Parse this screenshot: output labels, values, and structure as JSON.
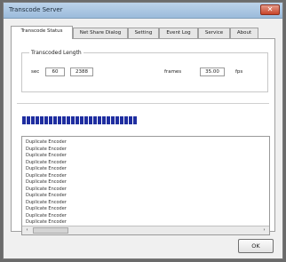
{
  "window": {
    "title": "Transcode Server",
    "close_glyph": "✕"
  },
  "tabs": [
    {
      "label": "Transcode Status",
      "active": true
    },
    {
      "label": "Net Share Dialog",
      "active": false
    },
    {
      "label": "Setting",
      "active": false
    },
    {
      "label": "Event Log",
      "active": false
    },
    {
      "label": "Service",
      "active": false
    },
    {
      "label": "About",
      "active": false
    }
  ],
  "transcoded_length": {
    "group_label": "Transcoded Length",
    "sec_label": "sec",
    "sec_value": "60",
    "frames_field_value": "2388",
    "frames_label": "frames",
    "fps_value": "35.00",
    "fps_label": "fps"
  },
  "progress": {
    "segments": 26
  },
  "log": {
    "lines": [
      "Duplicate Encoder",
      "Duplicate Encoder",
      "Duplicate Encoder",
      "Duplicate Encoder",
      "Duplicate Encoder",
      "Duplicate Encoder",
      "Duplicate Encoder",
      "Duplicate Encoder",
      "Duplicate Encoder",
      "Duplicate Encoder",
      "Duplicate Encoder",
      "Duplicate Encoder",
      "Duplicate Encoder"
    ],
    "scroll_left_glyph": "‹",
    "scroll_right_glyph": "›"
  },
  "buttons": {
    "ok_label": "OK"
  }
}
